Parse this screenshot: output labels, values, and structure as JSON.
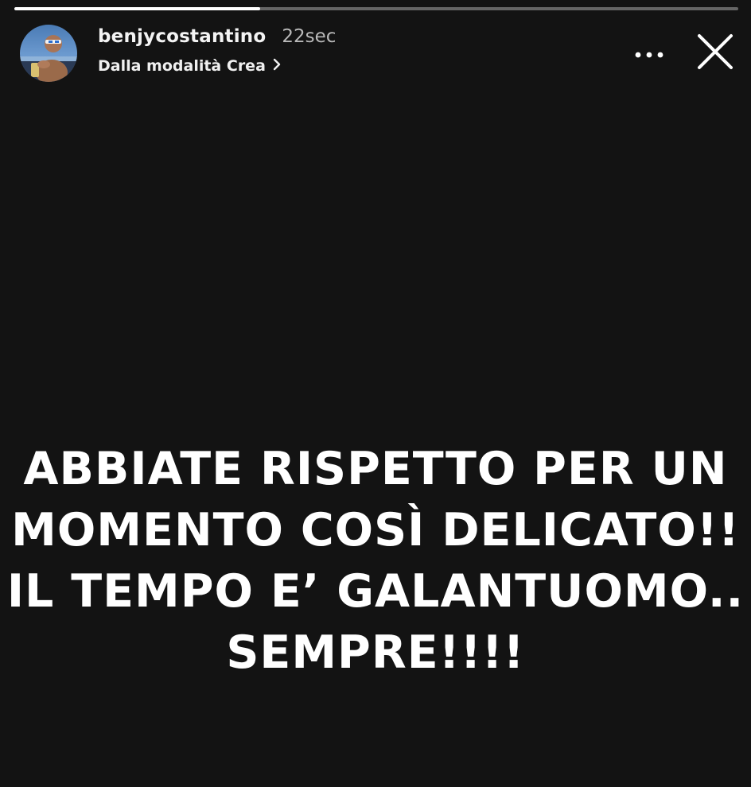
{
  "story": {
    "progress_percent": 34,
    "user": {
      "username": "benjycostantino",
      "timestamp": "22sec",
      "subtitle": "Dalla modalità Crea"
    },
    "message_lines": [
      "ABBIATE RISPETTO PER UN",
      "MOMENTO COSÌ DELICATO!!",
      "IL TEMPO E’ GALANTUOMO..",
      "SEMPRE!!!!"
    ]
  },
  "icons": {
    "more": "more-horizontal-icon",
    "close": "close-icon",
    "chevron": "chevron-right-icon"
  },
  "colors": {
    "background": "#131313",
    "text": "#ffffff",
    "timestamp": "#b9b9b9",
    "progress_track": "rgba(255,255,255,0.35)",
    "progress_fill": "#ffffff"
  }
}
